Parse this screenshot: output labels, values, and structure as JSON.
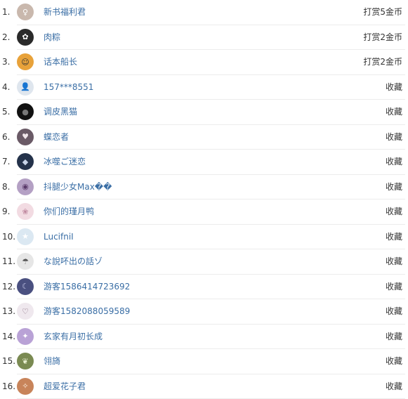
{
  "rows": [
    {
      "rank": "1.",
      "name": "新书福利君",
      "action": "打赏5金币",
      "avatar": "girl-portrait",
      "avatar_bg": "#c9b8ad",
      "avatar_fg": "#ffffff"
    },
    {
      "rank": "2.",
      "name": "肉粽",
      "action": "打赏2金币",
      "avatar": "flower-pattern",
      "avatar_bg": "#2a2a2a",
      "avatar_fg": "#ffffff"
    },
    {
      "rank": "3.",
      "name": "话本船长",
      "action": "打赏2金币",
      "avatar": "cartoon-pirate",
      "avatar_bg": "#e8a23a",
      "avatar_fg": "#333333"
    },
    {
      "rank": "4.",
      "name": "157***8551",
      "action": "收藏",
      "avatar": "default-user",
      "avatar_bg": "#dfe6ee",
      "avatar_fg": "#ffffff"
    },
    {
      "rank": "5.",
      "name": "调皮黑猫",
      "action": "收藏",
      "avatar": "black-cat",
      "avatar_bg": "#111111",
      "avatar_fg": "#777777"
    },
    {
      "rank": "6.",
      "name": "蝶恋者",
      "action": "收藏",
      "avatar": "anime-girl",
      "avatar_bg": "#6a5a66",
      "avatar_fg": "#f1e6ea"
    },
    {
      "rank": "7.",
      "name": "冰噬ご迷恋",
      "action": "收藏",
      "avatar": "dark-figure",
      "avatar_bg": "#24324a",
      "avatar_fg": "#c8d4e8"
    },
    {
      "rank": "8.",
      "name": "抖腿少女Max��",
      "action": "收藏",
      "avatar": "purple-eye",
      "avatar_bg": "#b4a0c4",
      "avatar_fg": "#5a3a6a"
    },
    {
      "rank": "9.",
      "name": "你们的瑾月鸭",
      "action": "收藏",
      "avatar": "pink-girl",
      "avatar_bg": "#f2dbe2",
      "avatar_fg": "#c08aa0"
    },
    {
      "rank": "10.",
      "name": "LucifniI",
      "action": "收藏",
      "avatar": "star",
      "avatar_bg": "#dbe8f2",
      "avatar_fg": "#ffffff"
    },
    {
      "rank": "11.",
      "name": "な說吥出の話ゾ",
      "action": "收藏",
      "avatar": "sad-figure",
      "avatar_bg": "#e6e6e6",
      "avatar_fg": "#555555"
    },
    {
      "rank": "12.",
      "name": "游客1586414723692",
      "action": "收藏",
      "avatar": "night-scene",
      "avatar_bg": "#4a5080",
      "avatar_fg": "#c6c8e8"
    },
    {
      "rank": "13.",
      "name": "游客1582088059589",
      "action": "收藏",
      "avatar": "chibi-girl",
      "avatar_bg": "#efe8ee",
      "avatar_fg": "#7a5a70"
    },
    {
      "rank": "14.",
      "name": "玄家有月初长成",
      "action": "收藏",
      "avatar": "purple-art",
      "avatar_bg": "#b9a2d6",
      "avatar_fg": "#ffffff"
    },
    {
      "rank": "15.",
      "name": "翎旖",
      "action": "收藏",
      "avatar": "green-scene",
      "avatar_bg": "#7a8a52",
      "avatar_fg": "#e8efd0"
    },
    {
      "rank": "16.",
      "name": "超爱花子君",
      "action": "收藏",
      "avatar": "anime-character",
      "avatar_bg": "#c8845a",
      "avatar_fg": "#fff0e0"
    }
  ]
}
